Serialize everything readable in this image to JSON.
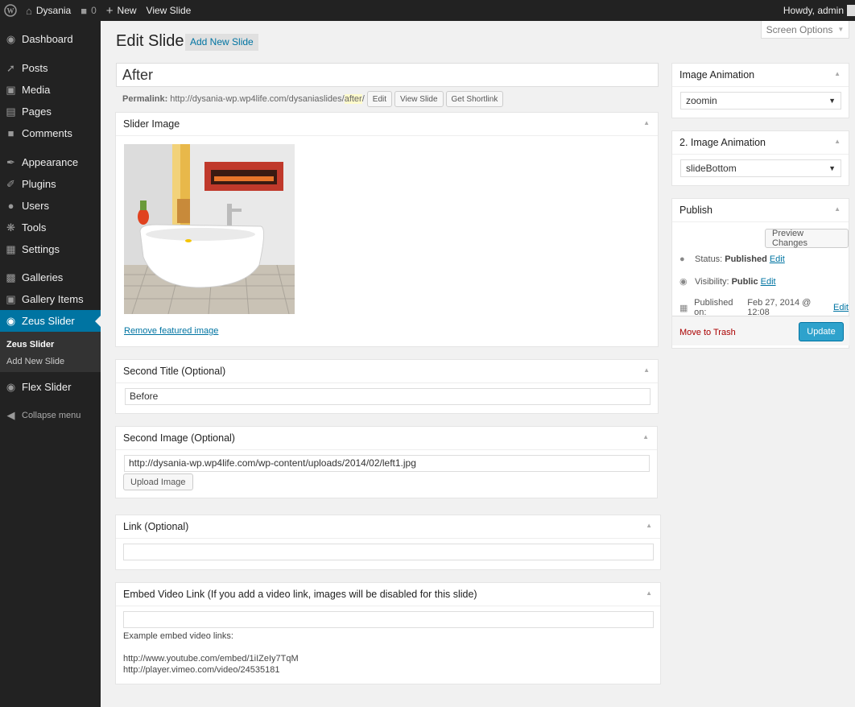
{
  "adminbar": {
    "site_name": "Dysania",
    "comments_count": "0",
    "new_label": "New",
    "view_slide": "View Slide",
    "howdy": "Howdy, admin"
  },
  "menu": {
    "items": [
      {
        "label": "Dashboard",
        "icon": "dashboard-icon"
      },
      {
        "label": "Posts",
        "icon": "pin-icon"
      },
      {
        "label": "Media",
        "icon": "media-icon"
      },
      {
        "label": "Pages",
        "icon": "pages-icon"
      },
      {
        "label": "Comments",
        "icon": "comment-icon"
      },
      {
        "label": "Appearance",
        "icon": "brush-icon"
      },
      {
        "label": "Plugins",
        "icon": "plugin-icon"
      },
      {
        "label": "Users",
        "icon": "user-icon"
      },
      {
        "label": "Tools",
        "icon": "wrench-icon"
      },
      {
        "label": "Settings",
        "icon": "settings-icon"
      },
      {
        "label": "Galleries",
        "icon": "folder-icon"
      },
      {
        "label": "Gallery Items",
        "icon": "gallery-icon"
      },
      {
        "label": "Zeus Slider",
        "icon": "camera-icon"
      },
      {
        "label": "Flex Slider",
        "icon": "camera-icon"
      }
    ],
    "submenu": [
      "Zeus Slider",
      "Add New Slide"
    ],
    "collapse": "Collapse menu"
  },
  "page": {
    "title": "Edit Slide",
    "add_new": "Add New Slide",
    "screen_options": "Screen Options",
    "post_title": "After",
    "permalink_label": "Permalink:",
    "permalink_base": "http://dysania-wp.wp4life.com/dysaniaslides/",
    "permalink_slug": "after",
    "permalink_end": "/",
    "edit_btn": "Edit",
    "view_btn": "View Slide",
    "shortlink_btn": "Get Shortlink"
  },
  "boxes": {
    "slider_image": {
      "title": "Slider Image",
      "remove": "Remove featured image"
    },
    "second_title": {
      "title": "Second Title (Optional)",
      "value": "Before"
    },
    "second_image": {
      "title": "Second Image (Optional)",
      "value": "http://dysania-wp.wp4life.com/wp-content/uploads/2014/02/left1.jpg",
      "upload": "Upload Image"
    },
    "link": {
      "title": "Link (Optional)",
      "value": ""
    },
    "embed": {
      "title": "Embed Video Link (If you add a video link, images will be disabled for this slide)",
      "value": "",
      "example_label": "Example embed video links:",
      "example1": "http://www.youtube.com/embed/1iIZeIy7TqM",
      "example2": "http://player.vimeo.com/video/24535181"
    }
  },
  "side": {
    "anim1": {
      "title": "Image Animation",
      "value": "zoomin"
    },
    "anim2": {
      "title": "2. Image Animation",
      "value": "slideBottom"
    },
    "publish": {
      "title": "Publish",
      "preview": "Preview Changes",
      "status_label": "Status:",
      "status_value": "Published",
      "visibility_label": "Visibility:",
      "visibility_value": "Public",
      "published_label": "Published on:",
      "published_value": "Feb 27, 2014 @ 12:08",
      "edit": "Edit",
      "trash": "Move to Trash",
      "update": "Update"
    }
  }
}
